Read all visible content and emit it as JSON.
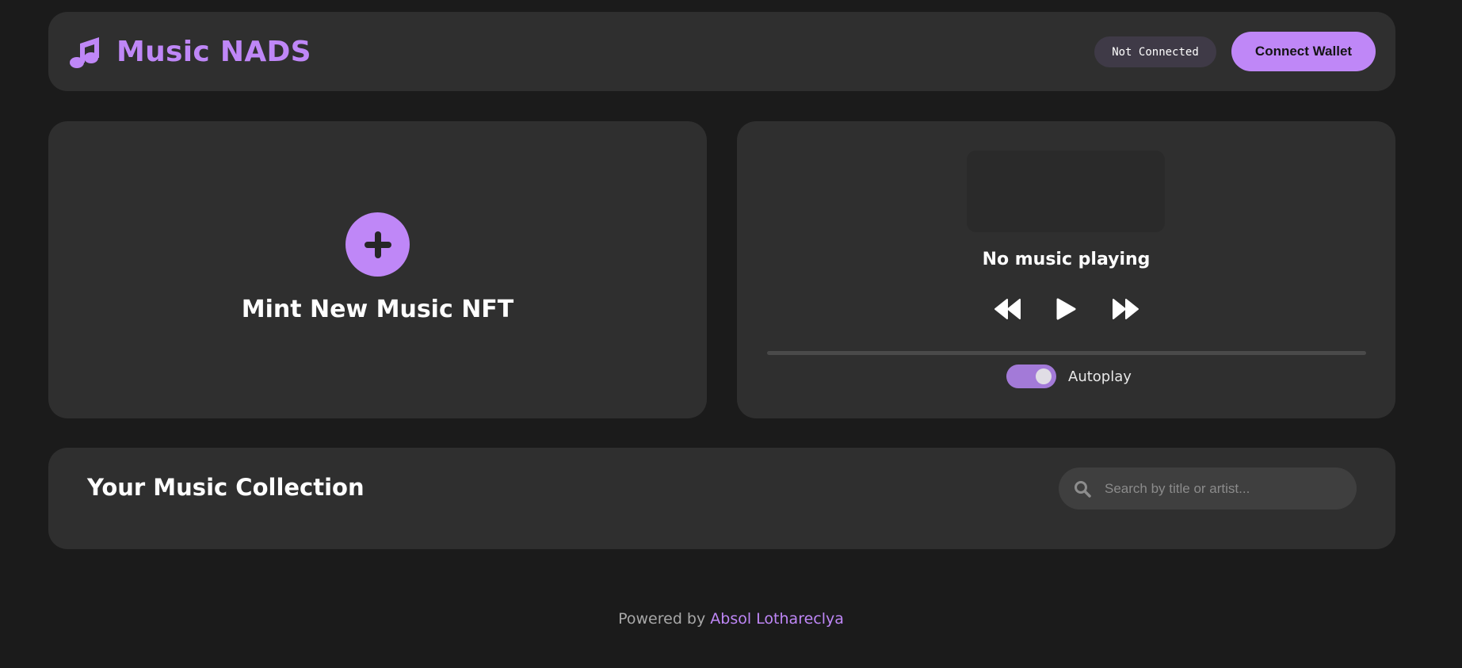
{
  "app": {
    "title": "Music NADS",
    "logo_icon": "music-note-icon",
    "accent_color": "#bf87f7",
    "background_color": "#1b1b1b",
    "panel_color": "#2f2f2f"
  },
  "header": {
    "connection_status": "Not Connected",
    "connect_button_label": "Connect Wallet"
  },
  "mint": {
    "icon": "plus-icon",
    "title": "Mint New Music NFT"
  },
  "player": {
    "now_playing": "No music playing",
    "controls": {
      "prev_icon": "rewind-icon",
      "play_icon": "play-icon",
      "next_icon": "fast-forward-icon"
    },
    "progress": 0,
    "autoplay_label": "Autoplay",
    "autoplay_enabled": true
  },
  "collection": {
    "title": "Your Music Collection",
    "search_icon": "search-icon",
    "search_placeholder": "Search by title or artist...",
    "search_value": ""
  },
  "footer": {
    "prefix": "Powered by",
    "author": "Absol Lothareclya"
  }
}
